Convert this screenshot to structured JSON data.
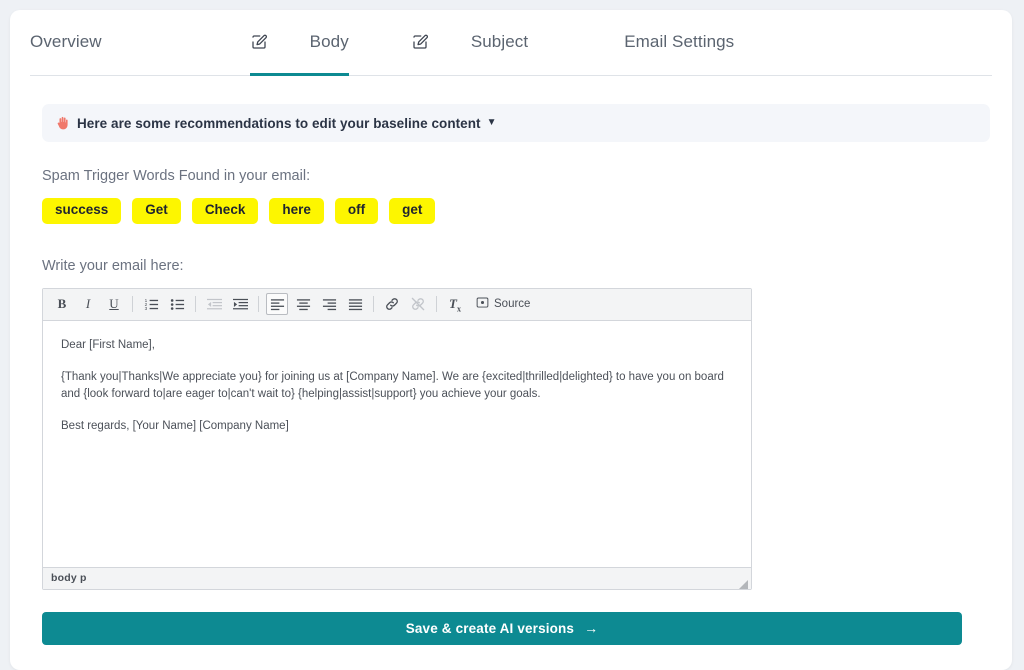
{
  "colors": {
    "accent_teal": "#0d8a92",
    "page_background": "#eef1f5",
    "card_background": "#ffffff",
    "banner_background": "#f4f6fa",
    "spam_chip_yellow": "#fdf600",
    "muted_text": "#6b7280"
  },
  "tabs": [
    {
      "label": "Overview",
      "icon": "",
      "active": false
    },
    {
      "label": "Body",
      "icon": "edit-icon",
      "active": true
    },
    {
      "label": "Subject",
      "icon": "edit-icon",
      "active": false
    },
    {
      "label": "Email Settings",
      "icon": "",
      "active": false
    }
  ],
  "banner": {
    "emoji": "raised-hand-emoji",
    "text": "Here are some recommendations to edit your baseline content",
    "caret": "▼"
  },
  "spam": {
    "label": "Spam Trigger Words Found in your email:",
    "words": [
      "success",
      "Get",
      "Check",
      "here",
      "off",
      "get"
    ]
  },
  "editor": {
    "label": "Write your email here:",
    "toolbar": [
      {
        "name": "bold-button",
        "glyph": "B",
        "state": "enabled"
      },
      {
        "name": "italic-button",
        "glyph": "I",
        "state": "enabled"
      },
      {
        "name": "underline-button",
        "glyph": "U",
        "state": "enabled"
      },
      {
        "name": "numbered-list-button",
        "glyph": "numbered-list-icon",
        "state": "enabled"
      },
      {
        "name": "bulleted-list-button",
        "glyph": "bulleted-list-icon",
        "state": "enabled"
      },
      {
        "name": "decrease-indent-button",
        "glyph": "outdent-icon",
        "state": "disabled"
      },
      {
        "name": "increase-indent-button",
        "glyph": "indent-icon",
        "state": "enabled"
      },
      {
        "name": "align-left-button",
        "glyph": "align-left-icon",
        "state": "active"
      },
      {
        "name": "align-center-button",
        "glyph": "align-center-icon",
        "state": "enabled"
      },
      {
        "name": "align-right-button",
        "glyph": "align-right-icon",
        "state": "enabled"
      },
      {
        "name": "align-justify-button",
        "glyph": "align-justify-icon",
        "state": "enabled"
      },
      {
        "name": "link-button",
        "glyph": "link-icon",
        "state": "enabled"
      },
      {
        "name": "unlink-button",
        "glyph": "unlink-icon",
        "state": "disabled"
      },
      {
        "name": "remove-format-button",
        "glyph": "Tx",
        "state": "enabled"
      },
      {
        "name": "source-button",
        "glyph": "source-icon",
        "state": "enabled"
      }
    ],
    "source_label": "Source",
    "content": {
      "greeting": "Dear [First Name],",
      "paragraph": "{Thank you|Thanks|We appreciate you} for joining us at [Company Name]. We are {excited|thrilled|delighted} to have you on board and {look forward to|are eager to|can't wait to} {helping|assist|support} you achieve your goals.",
      "signoff": "Best regards, [Your Name] [Company Name]"
    },
    "status_path": "body   p"
  },
  "save": {
    "label": "Save & create AI versions",
    "arrow": "→"
  }
}
